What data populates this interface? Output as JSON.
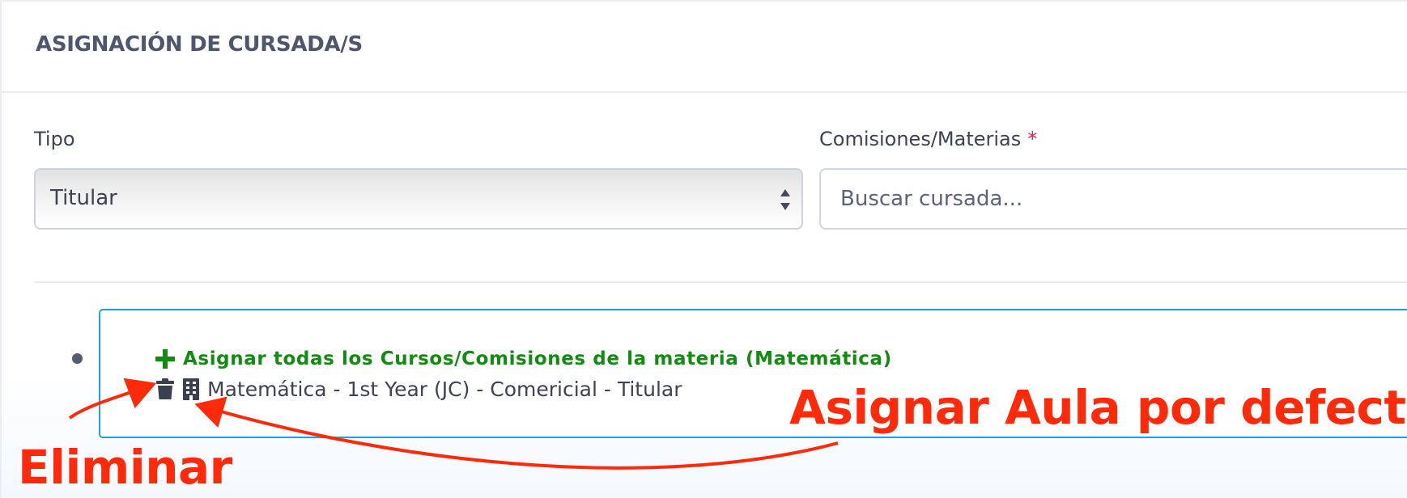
{
  "card": {
    "title": "ASIGNACIÓN DE CURSADA/S"
  },
  "form": {
    "tipo": {
      "label": "Tipo",
      "selected_value": "Titular"
    },
    "comisiones": {
      "label": "Comisiones/Materias",
      "required_mark": "*",
      "placeholder": "Buscar cursada..."
    }
  },
  "course_list": {
    "assign_all_label": "Asignar todas los Cursos/Comisiones de la materia (Matemática)",
    "items": [
      {
        "text": "Matemática - 1st Year (JC) - Comericial - Titular",
        "actions": [
          "trash-icon",
          "building-icon"
        ]
      }
    ]
  },
  "annotations": {
    "assign_default_room": "Asignar Aula por defecto",
    "delete": "Eliminar"
  },
  "colors": {
    "title": "#4e566b",
    "success_green": "#118c11",
    "primary_border": "#1ea0e6",
    "required_red": "#d9214e",
    "annotation_red": "#ff2a0a"
  }
}
